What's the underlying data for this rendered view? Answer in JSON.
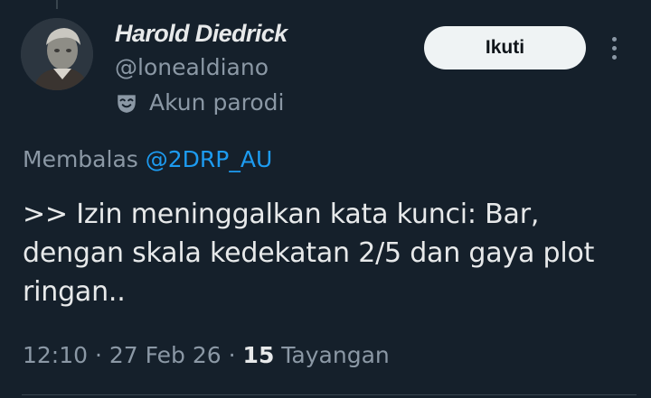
{
  "author": {
    "display_name": "Harold Diedrick",
    "handle": "@lonealdiano",
    "parody_label": "Akun parodi",
    "parody_icon": "mask-icon",
    "avatar_icon": "avatar-image"
  },
  "actions": {
    "follow_label": "Ikuti",
    "more_icon": "more-vertical-icon"
  },
  "reply": {
    "prefix": "Membalas",
    "mention": "@2DRP_AU"
  },
  "tweet": {
    "text": ">> Izin meninggalkan kata kunci: Bar, dengan skala kedekatan 2/5 dan gaya plot ringan.."
  },
  "meta": {
    "time": "12:10",
    "separator": "·",
    "date": "27 Feb 26",
    "views_count": "15",
    "views_label": "Tayangan"
  },
  "colors": {
    "background": "#15202b",
    "primary_text": "#e7e9ea",
    "secondary_text": "#8b98a5",
    "link": "#1d9bf0",
    "button_bg": "#eff3f4"
  }
}
